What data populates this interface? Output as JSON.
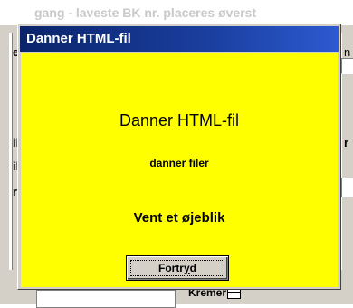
{
  "background": {
    "caption": "gang - laveste BK nr. placeres øverst",
    "left_fragments": [
      "elt",
      "il",
      "il",
      "r"
    ],
    "right_fragments": [
      "n",
      "r",
      "e"
    ],
    "bottom_label": "Kremer"
  },
  "dialog": {
    "title": "Danner HTML-fil",
    "heading": "Danner HTML-fil",
    "subtext": "danner filer",
    "wait_text": "Vent et øjeblik",
    "cancel_label": "Fortryd"
  },
  "colors": {
    "titlebar": "#0a246a",
    "content_bg": "#ffff00",
    "window_face": "#d4d0c8"
  },
  "icons": {
    "bottom_label_icon": "table-icon"
  }
}
